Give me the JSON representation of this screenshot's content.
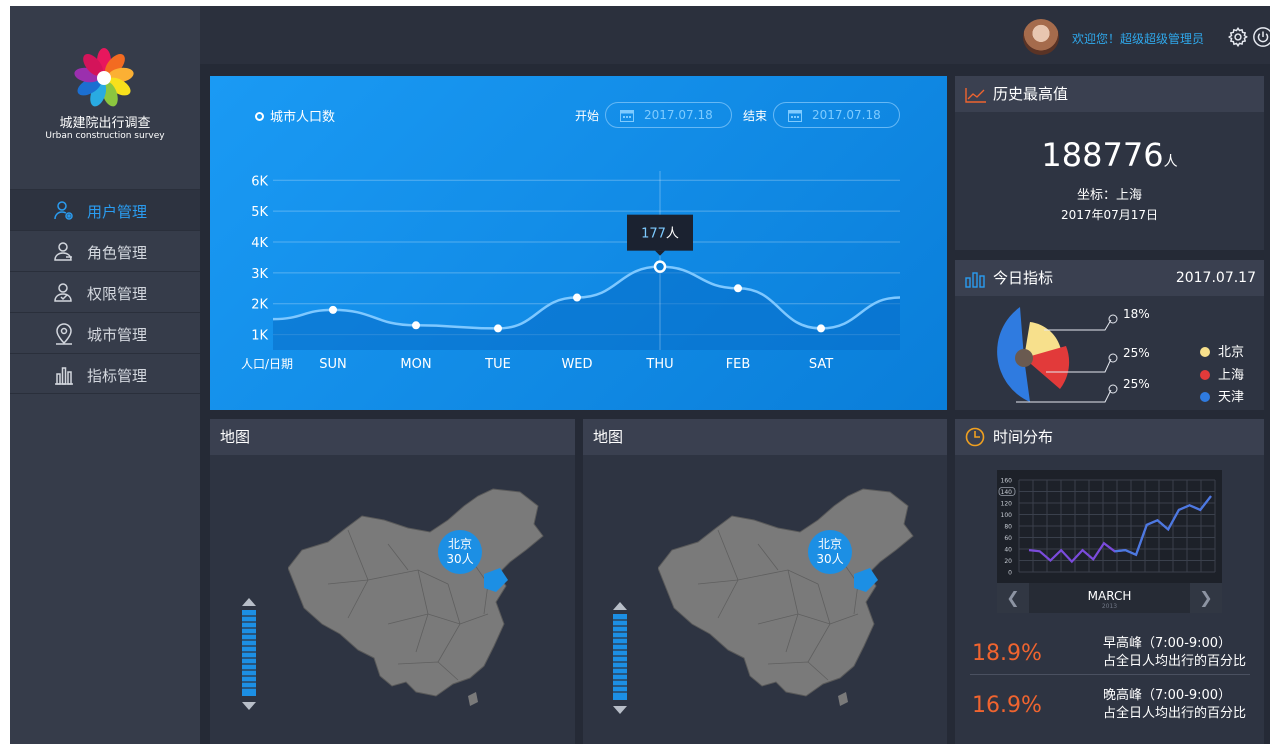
{
  "brand": {
    "title": "城建院出行调查",
    "subtitle": "Urban construction survey"
  },
  "nav": [
    {
      "label": "用户管理",
      "icon": "user-gear-icon",
      "active": true
    },
    {
      "label": "角色管理",
      "icon": "user-role-icon",
      "active": false
    },
    {
      "label": "权限管理",
      "icon": "user-permission-icon",
      "active": false
    },
    {
      "label": "城市管理",
      "icon": "location-pin-icon",
      "active": false
    },
    {
      "label": "指标管理",
      "icon": "bar-chart-icon",
      "active": false
    }
  ],
  "header": {
    "welcome": "欢迎您！超级超级管理员"
  },
  "population": {
    "legend": "城市人口数",
    "start_label": "开始",
    "start_date": "2017.07.18",
    "end_label": "结束",
    "end_date": "2017.07.18",
    "tooltip_value": "177",
    "tooltip_unit": "人"
  },
  "chart_data": [
    {
      "type": "area",
      "series": [
        {
          "name": "城市人口数",
          "values": [
            1.8,
            1.3,
            1.2,
            2.2,
            3.2,
            2.5,
            1.2
          ]
        }
      ],
      "categories": [
        "SUN",
        "MON",
        "TUE",
        "WED",
        "THU",
        "FEB",
        "SAT"
      ],
      "x_axis_label": "人口/日期",
      "y_ticks": [
        "1K",
        "2K",
        "3K",
        "4K",
        "5K",
        "6K"
      ],
      "ylim": [
        0.5,
        6.3
      ],
      "highlight_index": 4,
      "grid": "horizontal"
    },
    {
      "type": "pie",
      "categories": [
        "北京",
        "上海",
        "天津"
      ],
      "labels": [
        "18%",
        "25%",
        "25%"
      ],
      "colors": [
        "#f7e08c",
        "#e23a3a",
        "#2f7be0"
      ]
    },
    {
      "type": "line",
      "y_ticks": [
        "0",
        "20",
        "40",
        "60",
        "80",
        "100",
        "120",
        "140",
        "160"
      ],
      "ylim": [
        0,
        160
      ],
      "highlight_tick": "140",
      "values": [
        38,
        36,
        20,
        38,
        18,
        38,
        22,
        50,
        36,
        38,
        30,
        82,
        90,
        74,
        108,
        116,
        108,
        132
      ],
      "colors": [
        "#7b4bdc",
        "#4b7ae0"
      ],
      "grid": true
    }
  ],
  "history": {
    "title": "历史最高值",
    "value": "188776",
    "unit": "人",
    "coord": "坐标：上海",
    "date": "2017年07月17日"
  },
  "today": {
    "title": "今日指标",
    "date": "2017.07.17",
    "legend": [
      {
        "label": "北京",
        "color": "#f7e08c"
      },
      {
        "label": "上海",
        "color": "#e23a3a"
      },
      {
        "label": "天津",
        "color": "#2f7be0"
      }
    ]
  },
  "maps": [
    {
      "title": "地图",
      "bubble_city": "北京",
      "bubble_value": "30人"
    },
    {
      "title": "地图",
      "bubble_city": "北京",
      "bubble_value": "30人"
    }
  ],
  "time": {
    "title": "时间分布",
    "month": "MARCH",
    "year": "2013",
    "stats": [
      {
        "pct": "18.9%",
        "line1": "早高峰（7:00-9:00）",
        "line2": "占全日人均出行的百分比"
      },
      {
        "pct": "16.9%",
        "line1": "晚高峰（7:00-9:00）",
        "line2": "占全日人均出行的百分比"
      }
    ]
  },
  "colors": {
    "accent": "#2a9cf0",
    "chart_bg": "#0a7ed9",
    "highlight": "#f0642f"
  }
}
